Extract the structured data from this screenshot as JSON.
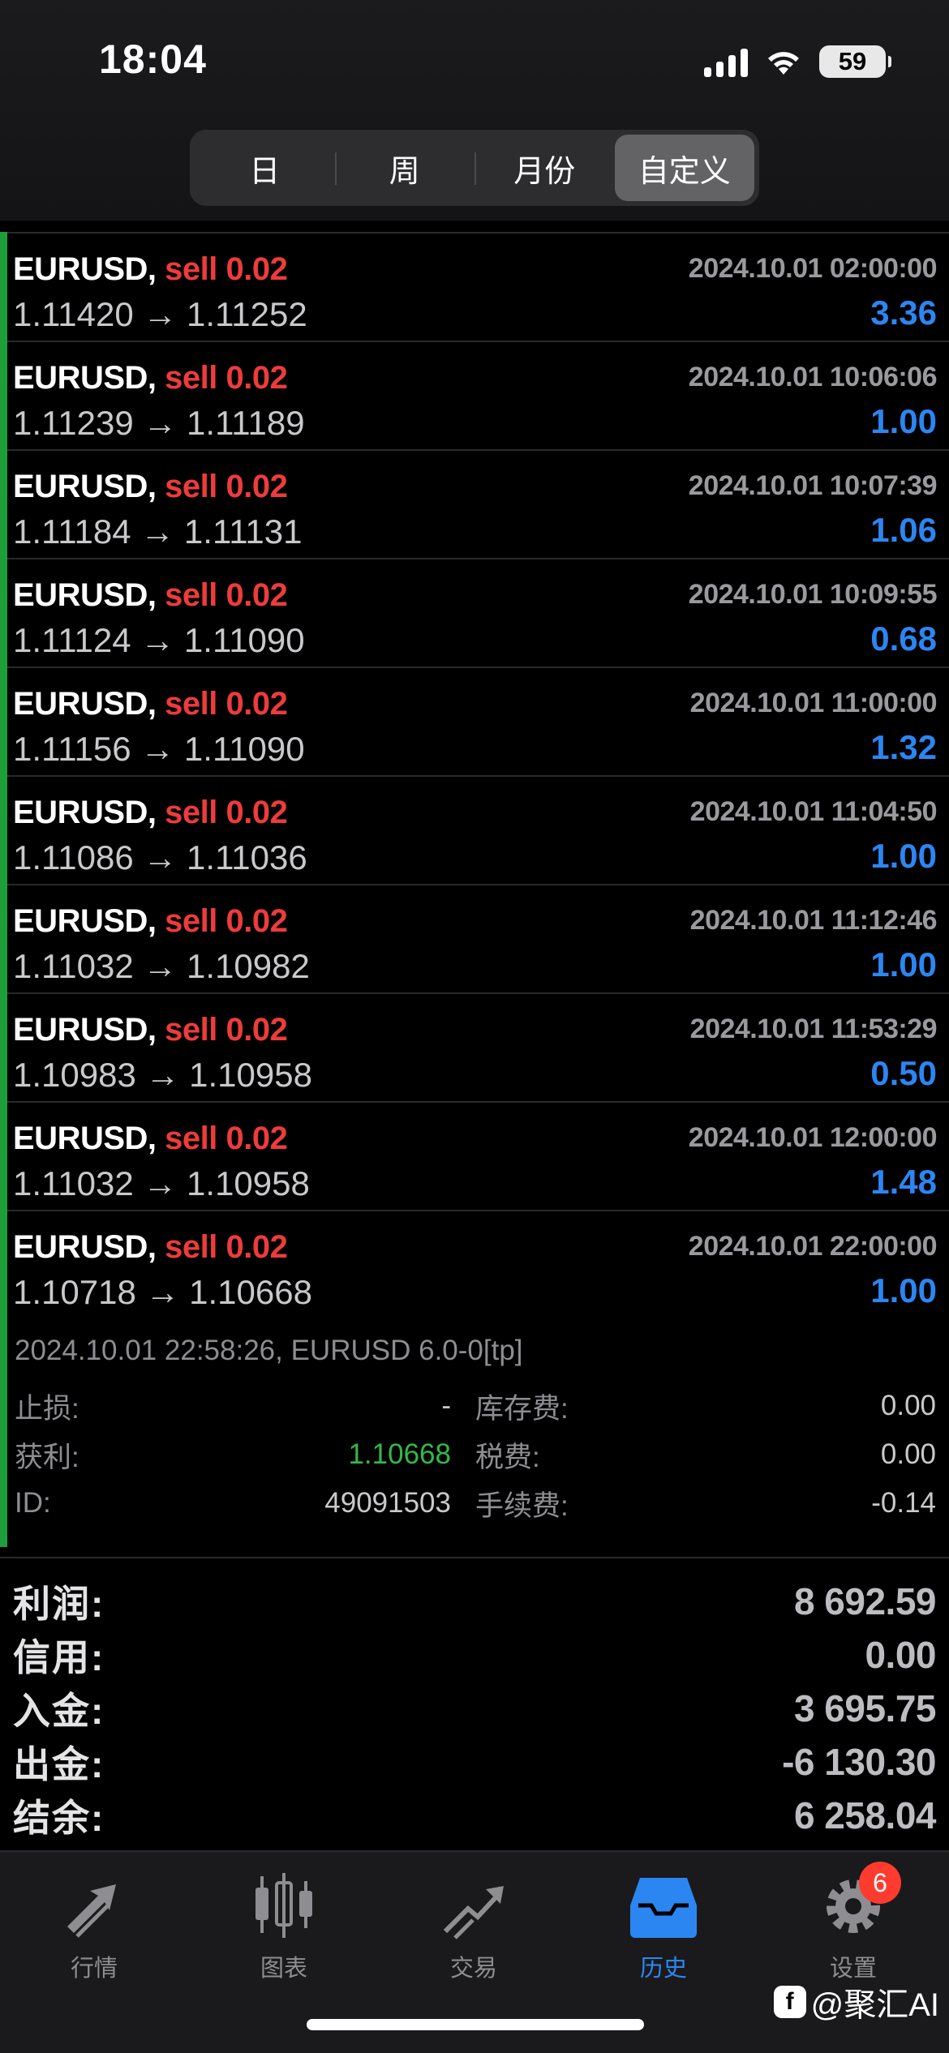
{
  "status_bar": {
    "time": "18:04",
    "battery": "59"
  },
  "segments": [
    {
      "label": "日",
      "active": false
    },
    {
      "label": "周",
      "active": false
    },
    {
      "label": "月份",
      "active": false
    },
    {
      "label": "自定义",
      "active": true
    }
  ],
  "trades": [
    {
      "symbol": "EURUSD,",
      "side": "sell 0.02",
      "time": "2024.10.01 02:00:00",
      "prices": "1.11420 → 1.11252",
      "profit": "3.36"
    },
    {
      "symbol": "EURUSD,",
      "side": "sell 0.02",
      "time": "2024.10.01 10:06:06",
      "prices": "1.11239 → 1.11189",
      "profit": "1.00"
    },
    {
      "symbol": "EURUSD,",
      "side": "sell 0.02",
      "time": "2024.10.01 10:07:39",
      "prices": "1.11184 → 1.11131",
      "profit": "1.06"
    },
    {
      "symbol": "EURUSD,",
      "side": "sell 0.02",
      "time": "2024.10.01 10:09:55",
      "prices": "1.11124 → 1.11090",
      "profit": "0.68"
    },
    {
      "symbol": "EURUSD,",
      "side": "sell 0.02",
      "time": "2024.10.01 11:00:00",
      "prices": "1.11156 → 1.11090",
      "profit": "1.32"
    },
    {
      "symbol": "EURUSD,",
      "side": "sell 0.02",
      "time": "2024.10.01 11:04:50",
      "prices": "1.11086 → 1.11036",
      "profit": "1.00"
    },
    {
      "symbol": "EURUSD,",
      "side": "sell 0.02",
      "time": "2024.10.01 11:12:46",
      "prices": "1.11032 → 1.10982",
      "profit": "1.00"
    },
    {
      "symbol": "EURUSD,",
      "side": "sell 0.02",
      "time": "2024.10.01 11:53:29",
      "prices": "1.10983 → 1.10958",
      "profit": "0.50"
    },
    {
      "symbol": "EURUSD,",
      "side": "sell 0.02",
      "time": "2024.10.01 12:00:00",
      "prices": "1.11032 → 1.10958",
      "profit": "1.48"
    },
    {
      "symbol": "EURUSD,",
      "side": "sell 0.02",
      "time": "2024.10.01 22:00:00",
      "prices": "1.10718 → 1.10668",
      "profit": "1.00"
    }
  ],
  "detail": {
    "summary": "2024.10.01 22:58:26, EURUSD 6.0-0[tp]",
    "stop_loss_label": "止损:",
    "stop_loss": "-",
    "swap_label": "库存费:",
    "swap": "0.00",
    "take_profit_label": "获利:",
    "take_profit": "1.10668",
    "tax_label": "税费:",
    "tax": "0.00",
    "id_label": "ID:",
    "id": "49091503",
    "commission_label": "手续费:",
    "commission": "-0.14"
  },
  "totals": [
    {
      "label": "利润:",
      "value": "8 692.59"
    },
    {
      "label": "信用:",
      "value": "0.00"
    },
    {
      "label": "入金:",
      "value": "3 695.75"
    },
    {
      "label": "出金:",
      "value": "-6 130.30"
    },
    {
      "label": "结余:",
      "value": "6 258.04"
    }
  ],
  "tabs": [
    {
      "label": "行情",
      "icon": "quotes-icon"
    },
    {
      "label": "图表",
      "icon": "chart-icon"
    },
    {
      "label": "交易",
      "icon": "trade-icon"
    },
    {
      "label": "历史",
      "icon": "history-icon"
    },
    {
      "label": "设置",
      "icon": "settings-icon",
      "badge": "6"
    }
  ],
  "watermark": "@聚汇AI",
  "colors": {
    "sell": "#ee3b3b",
    "profit": "#2c86f2",
    "green": "#34b84a",
    "tab_active": "#2c86f2"
  }
}
